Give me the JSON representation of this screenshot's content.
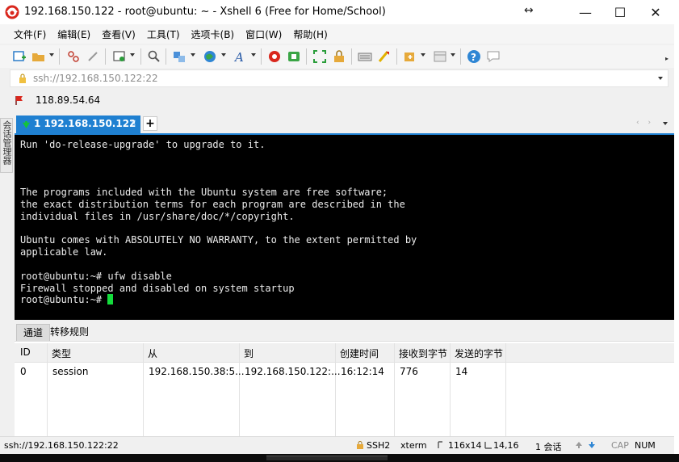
{
  "window": {
    "title": "192.168.150.122 - root@ubuntu: ~ - Xshell 6 (Free for Home/School)",
    "controls": {
      "minimize": "—",
      "maximize": "☐",
      "close": "✕",
      "resize_glyph": "↔"
    }
  },
  "menu": [
    "文件(F)",
    "编辑(E)",
    "查看(V)",
    "工具(T)",
    "选项卡(B)",
    "窗口(W)",
    "帮助(H)"
  ],
  "toolbar": {
    "icons": [
      "new-session-icon",
      "open-folder-icon",
      "disconnect-icon",
      "reconnect-icon",
      "new-window-icon",
      "find-icon",
      "transfer-icon",
      "globe-icon",
      "font-icon",
      "xftp-icon",
      "xmanager-icon",
      "fullscreen-icon",
      "lock-icon",
      "keyboard-icon",
      "highlight-icon",
      "compose-icon",
      "layout-icon",
      "help-icon",
      "chat-icon"
    ],
    "overflow": "▸"
  },
  "address_bar": {
    "value": "ssh://192.168.150.122:22"
  },
  "links_bar": {
    "label": "118.89.54.64"
  },
  "side_strip": {
    "label": "会话管理器"
  },
  "tabs": {
    "items": [
      {
        "label": "1 192.168.150.122",
        "close": "×"
      }
    ],
    "add": "+",
    "nav": "‹ ›"
  },
  "terminal": {
    "lines": [
      "Run 'do-release-upgrade' to upgrade to it.",
      "",
      "",
      "",
      "The programs included with the Ubuntu system are free software;",
      "the exact distribution terms for each program are described in the",
      "individual files in /usr/share/doc/*/copyright.",
      "",
      "Ubuntu comes with ABSOLUTELY NO WARRANTY, to the extent permitted by",
      "applicable law.",
      "",
      "root@ubuntu:~# ufw disable",
      "Firewall stopped and disabled on system startup"
    ],
    "prompt": "root@ubuntu:~# "
  },
  "panel": {
    "tabs": [
      "通道",
      "转移规则"
    ],
    "columns": [
      "ID",
      "类型",
      "从",
      "到",
      "创建时间",
      "接收到字节",
      "发送的字节"
    ],
    "rows": [
      [
        "0",
        "session",
        "192.168.150.38:5...",
        "192.168.150.122:...",
        "16:12:14",
        "776",
        "14"
      ]
    ]
  },
  "status_bar": {
    "address": "ssh://192.168.150.122:22",
    "protocol": "SSH2",
    "terminal_type": "xterm",
    "size": "116x14",
    "position": "14,16",
    "sessions": "1 会话",
    "caps": "CAP",
    "num": "NUM"
  },
  "colors": {
    "accent": "#1f80d1",
    "terminal_bg": "#000000",
    "terminal_fg": "#ececec",
    "cursor": "#14dc3c"
  }
}
